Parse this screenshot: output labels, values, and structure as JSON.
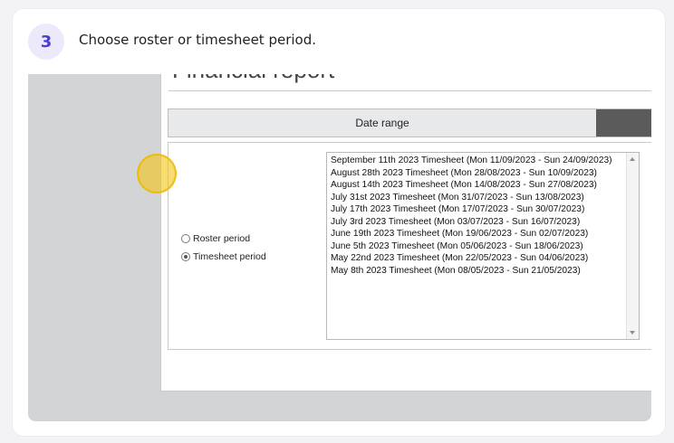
{
  "step": {
    "number": "3",
    "instruction": "Choose roster or timesheet period."
  },
  "report": {
    "title": "Financial report",
    "date_range_label": "Date range",
    "period_options": [
      {
        "label": "Roster period",
        "selected": false
      },
      {
        "label": "Timesheet period",
        "selected": true
      }
    ],
    "timesheets": [
      "September 11th 2023 Timesheet (Mon 11/09/2023 - Sun 24/09/2023)",
      "August 28th 2023 Timesheet (Mon 28/08/2023 - Sun 10/09/2023)",
      "August 14th 2023 Timesheet (Mon 14/08/2023 - Sun 27/08/2023)",
      "July 31st 2023 Timesheet (Mon 31/07/2023 - Sun 13/08/2023)",
      "July 17th 2023 Timesheet (Mon 17/07/2023 - Sun 30/07/2023)",
      "July 3rd 2023 Timesheet (Mon 03/07/2023 - Sun 16/07/2023)",
      "June 19th 2023 Timesheet (Mon 19/06/2023 - Sun 02/07/2023)",
      "June 5th 2023 Timesheet (Mon 05/06/2023 - Sun 18/06/2023)",
      "May 22nd 2023 Timesheet (Mon 22/05/2023 - Sun 04/06/2023)",
      "May 8th 2023 Timesheet (Mon 08/05/2023 - Sun 21/05/2023)"
    ]
  },
  "colors": {
    "accent": "#4b3fd1",
    "badge_bg": "#ece9fb",
    "highlight": "#f2c414"
  }
}
